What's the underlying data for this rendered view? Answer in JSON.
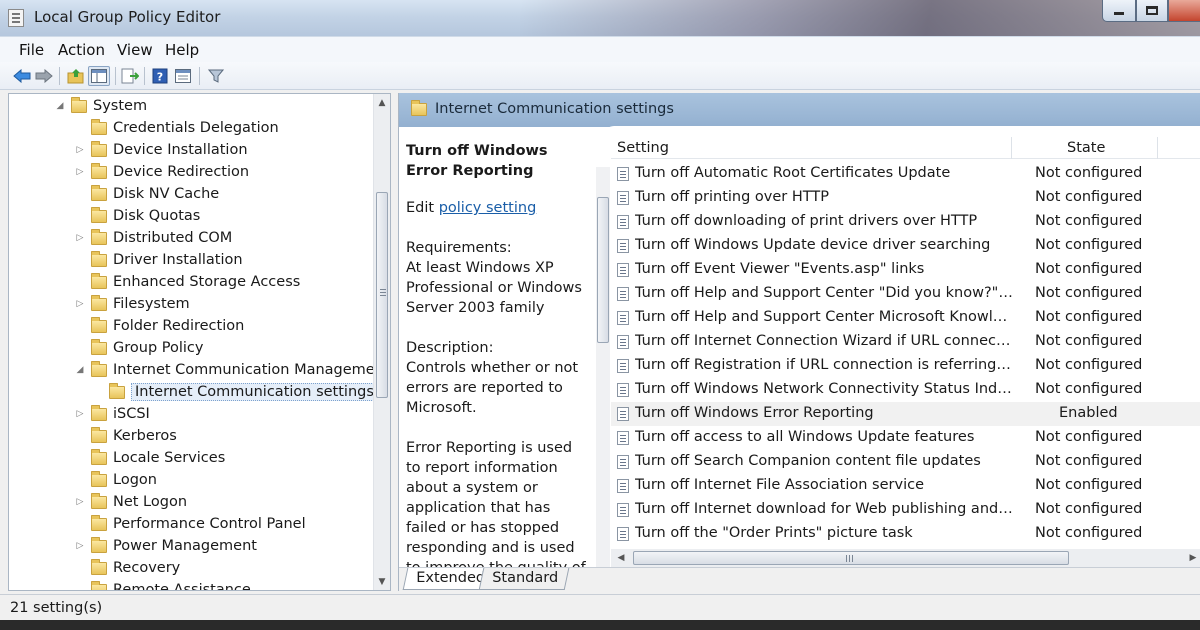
{
  "window": {
    "title": "Local Group Policy Editor"
  },
  "menu": [
    "File",
    "Action",
    "View",
    "Help"
  ],
  "toolbar": {
    "icons": [
      "back-icon",
      "forward-icon",
      "up-folder-icon",
      "show-hide-tree-icon",
      "export-list-icon",
      "help-icon",
      "properties-icon",
      "filter-icon"
    ]
  },
  "tree": {
    "items": [
      {
        "label": "System",
        "expanded": true,
        "level": 0
      },
      {
        "label": "Credentials Delegation",
        "expander": false
      },
      {
        "label": "Device Installation",
        "expander": true
      },
      {
        "label": "Device Redirection",
        "expander": true
      },
      {
        "label": "Disk NV Cache",
        "expander": false
      },
      {
        "label": "Disk Quotas",
        "expander": false
      },
      {
        "label": "Distributed COM",
        "expander": true
      },
      {
        "label": "Driver Installation",
        "expander": false
      },
      {
        "label": "Enhanced Storage Access",
        "expander": false
      },
      {
        "label": "Filesystem",
        "expander": true
      },
      {
        "label": "Folder Redirection",
        "expander": false
      },
      {
        "label": "Group Policy",
        "expander": false
      },
      {
        "label": "Internet Communication Management",
        "expanded": true
      },
      {
        "label": "Internet Communication settings",
        "selected": true,
        "level": 2
      },
      {
        "label": "iSCSI",
        "expander": true
      },
      {
        "label": "Kerberos",
        "expander": false
      },
      {
        "label": "Locale Services",
        "expander": false
      },
      {
        "label": "Logon",
        "expander": false
      },
      {
        "label": "Net Logon",
        "expander": true
      },
      {
        "label": "Performance Control Panel",
        "expander": false
      },
      {
        "label": "Power Management",
        "expander": true
      },
      {
        "label": "Recovery",
        "expander": false
      },
      {
        "label": "Remote Assistance",
        "expander": false
      }
    ]
  },
  "details": {
    "header": "Internet Communication settings",
    "heading": "Turn off Windows Error Reporting",
    "edit_prefix": "Edit ",
    "edit_link": "policy setting ",
    "requirements_label": "Requirements:",
    "requirements_text": "At least Windows XP Professional or Windows Server 2003 family",
    "description_label": "Description:",
    "description_text": "Controls whether or not errors are reported to Microsoft.",
    "error_text": "Error Reporting is used to report information about a system or application that has failed or has stopped responding and is used to improve the quality of the"
  },
  "list": {
    "columns": {
      "setting": "Setting",
      "state": "State"
    },
    "rows": [
      {
        "name": "Turn off Automatic Root Certificates Update",
        "state": "Not configured"
      },
      {
        "name": "Turn off printing over HTTP",
        "state": "Not configured"
      },
      {
        "name": "Turn off downloading of print drivers over HTTP",
        "state": "Not configured"
      },
      {
        "name": "Turn off Windows Update device driver searching",
        "state": "Not configured"
      },
      {
        "name": "Turn off Event Viewer \"Events.asp\" links",
        "state": "Not configured"
      },
      {
        "name": "Turn off Help and Support Center \"Did you know?\" cont...",
        "state": "Not configured"
      },
      {
        "name": "Turn off Help and Support Center Microsoft Knowledge...",
        "state": "Not configured"
      },
      {
        "name": "Turn off Internet Connection Wizard if URL connection i...",
        "state": "Not configured"
      },
      {
        "name": "Turn off Registration if URL connection is referring to M...",
        "state": "Not configured"
      },
      {
        "name": "Turn off Windows Network Connectivity Status Indicato...",
        "state": "Not configured"
      },
      {
        "name": "Turn off Windows Error Reporting",
        "state": "Enabled",
        "selected": true
      },
      {
        "name": "Turn off access to all Windows Update features",
        "state": "Not configured"
      },
      {
        "name": "Turn off Search Companion content file updates",
        "state": "Not configured"
      },
      {
        "name": "Turn off Internet File Association service",
        "state": "Not configured"
      },
      {
        "name": "Turn off Internet download for Web publishing and onli...",
        "state": "Not configured"
      },
      {
        "name": "Turn off the \"Order Prints\" picture task",
        "state": "Not configured"
      }
    ]
  },
  "tabs": [
    "Extended",
    "Standard"
  ],
  "status": "21 setting(s)"
}
